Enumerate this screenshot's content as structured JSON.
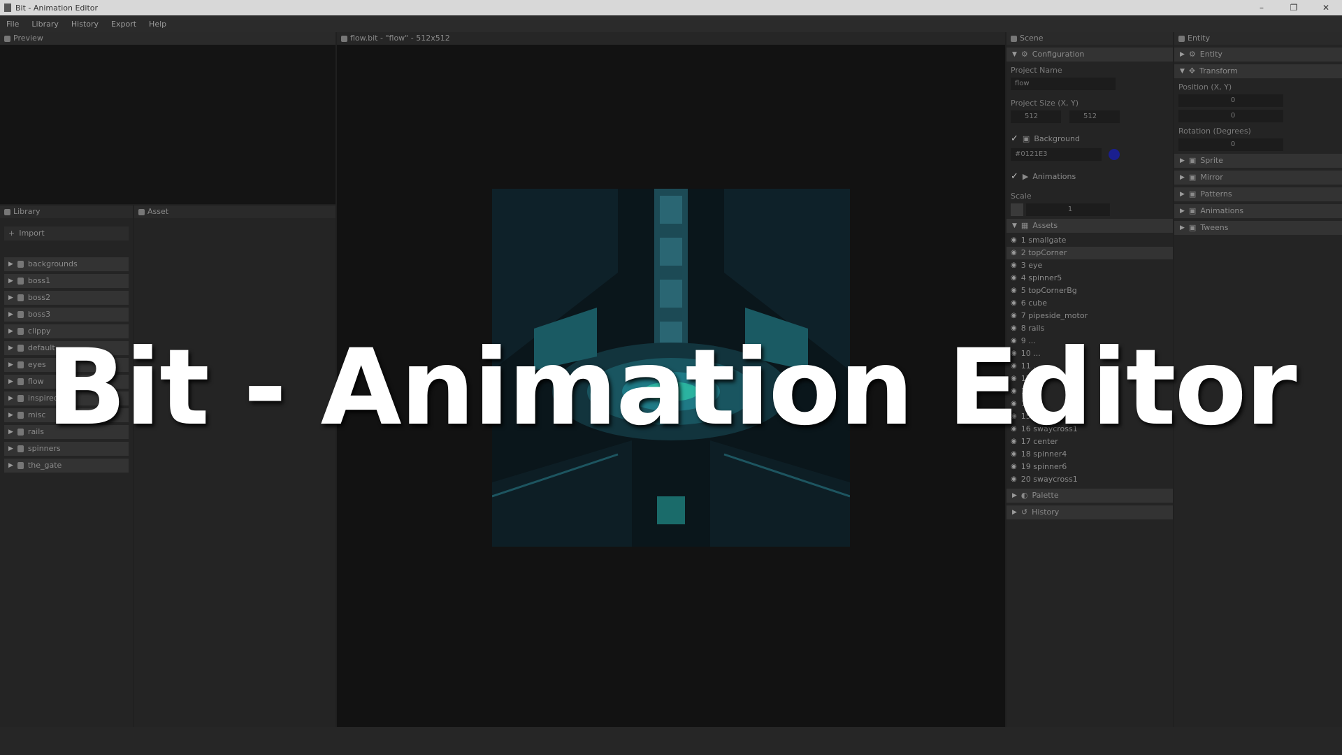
{
  "window": {
    "title": "Bit - Animation Editor",
    "controls": [
      "–",
      "❐",
      "✕"
    ]
  },
  "menu": [
    "File",
    "Library",
    "History",
    "Export",
    "Help"
  ],
  "preview": {
    "title": "Preview"
  },
  "library": {
    "title": "Library",
    "import_label": "Import",
    "items": [
      "backgrounds",
      "boss1",
      "boss2",
      "boss3",
      "clippy",
      "default",
      "eyes",
      "flow",
      "inspired_x",
      "misc",
      "rails",
      "spinners",
      "the_gate"
    ]
  },
  "asset": {
    "title": "Asset"
  },
  "canvas": {
    "title": "flow.bit - \"flow\" - 512x512"
  },
  "scene": {
    "title": "Scene",
    "configuration_label": "Configuration",
    "project_name_label": "Project Name",
    "project_name_value": "flow",
    "project_size_label": "Project Size (X, Y)",
    "project_size_x": "512",
    "project_size_y": "512",
    "background_label": "Background",
    "background_hex": "#0121E3",
    "background_color": "#1a1f8f",
    "animations_label": "Animations",
    "scale_label": "Scale",
    "scale_value": "1",
    "assets_label": "Assets",
    "assets": [
      "1 smallgate",
      "2 topCorner",
      "3 eye",
      "4 spinner5",
      "5 topCornerBg",
      "6 cube",
      "7 pipeside_motor",
      "8 rails",
      "9 ...",
      "10 ...",
      "11 ...",
      "12 ...",
      "13 ...",
      "14 ...",
      "15 sidePipe4",
      "16 swaycross1",
      "17 center",
      "18 spinner4",
      "19 spinner6",
      "20 swaycross1"
    ],
    "selected_asset_index": 1,
    "palette_label": "Palette",
    "history_label": "History"
  },
  "entity": {
    "title": "Entity",
    "entity_label": "Entity",
    "transform_label": "Transform",
    "position_label": "Position (X, Y)",
    "position_x": "0",
    "position_y": "0",
    "rotation_label": "Rotation (Degrees)",
    "rotation_value": "0",
    "sections": [
      "Sprite",
      "Mirror",
      "Patterns",
      "Animations",
      "Tweens"
    ]
  },
  "overlay": {
    "text": "Bit - Animation Editor"
  }
}
